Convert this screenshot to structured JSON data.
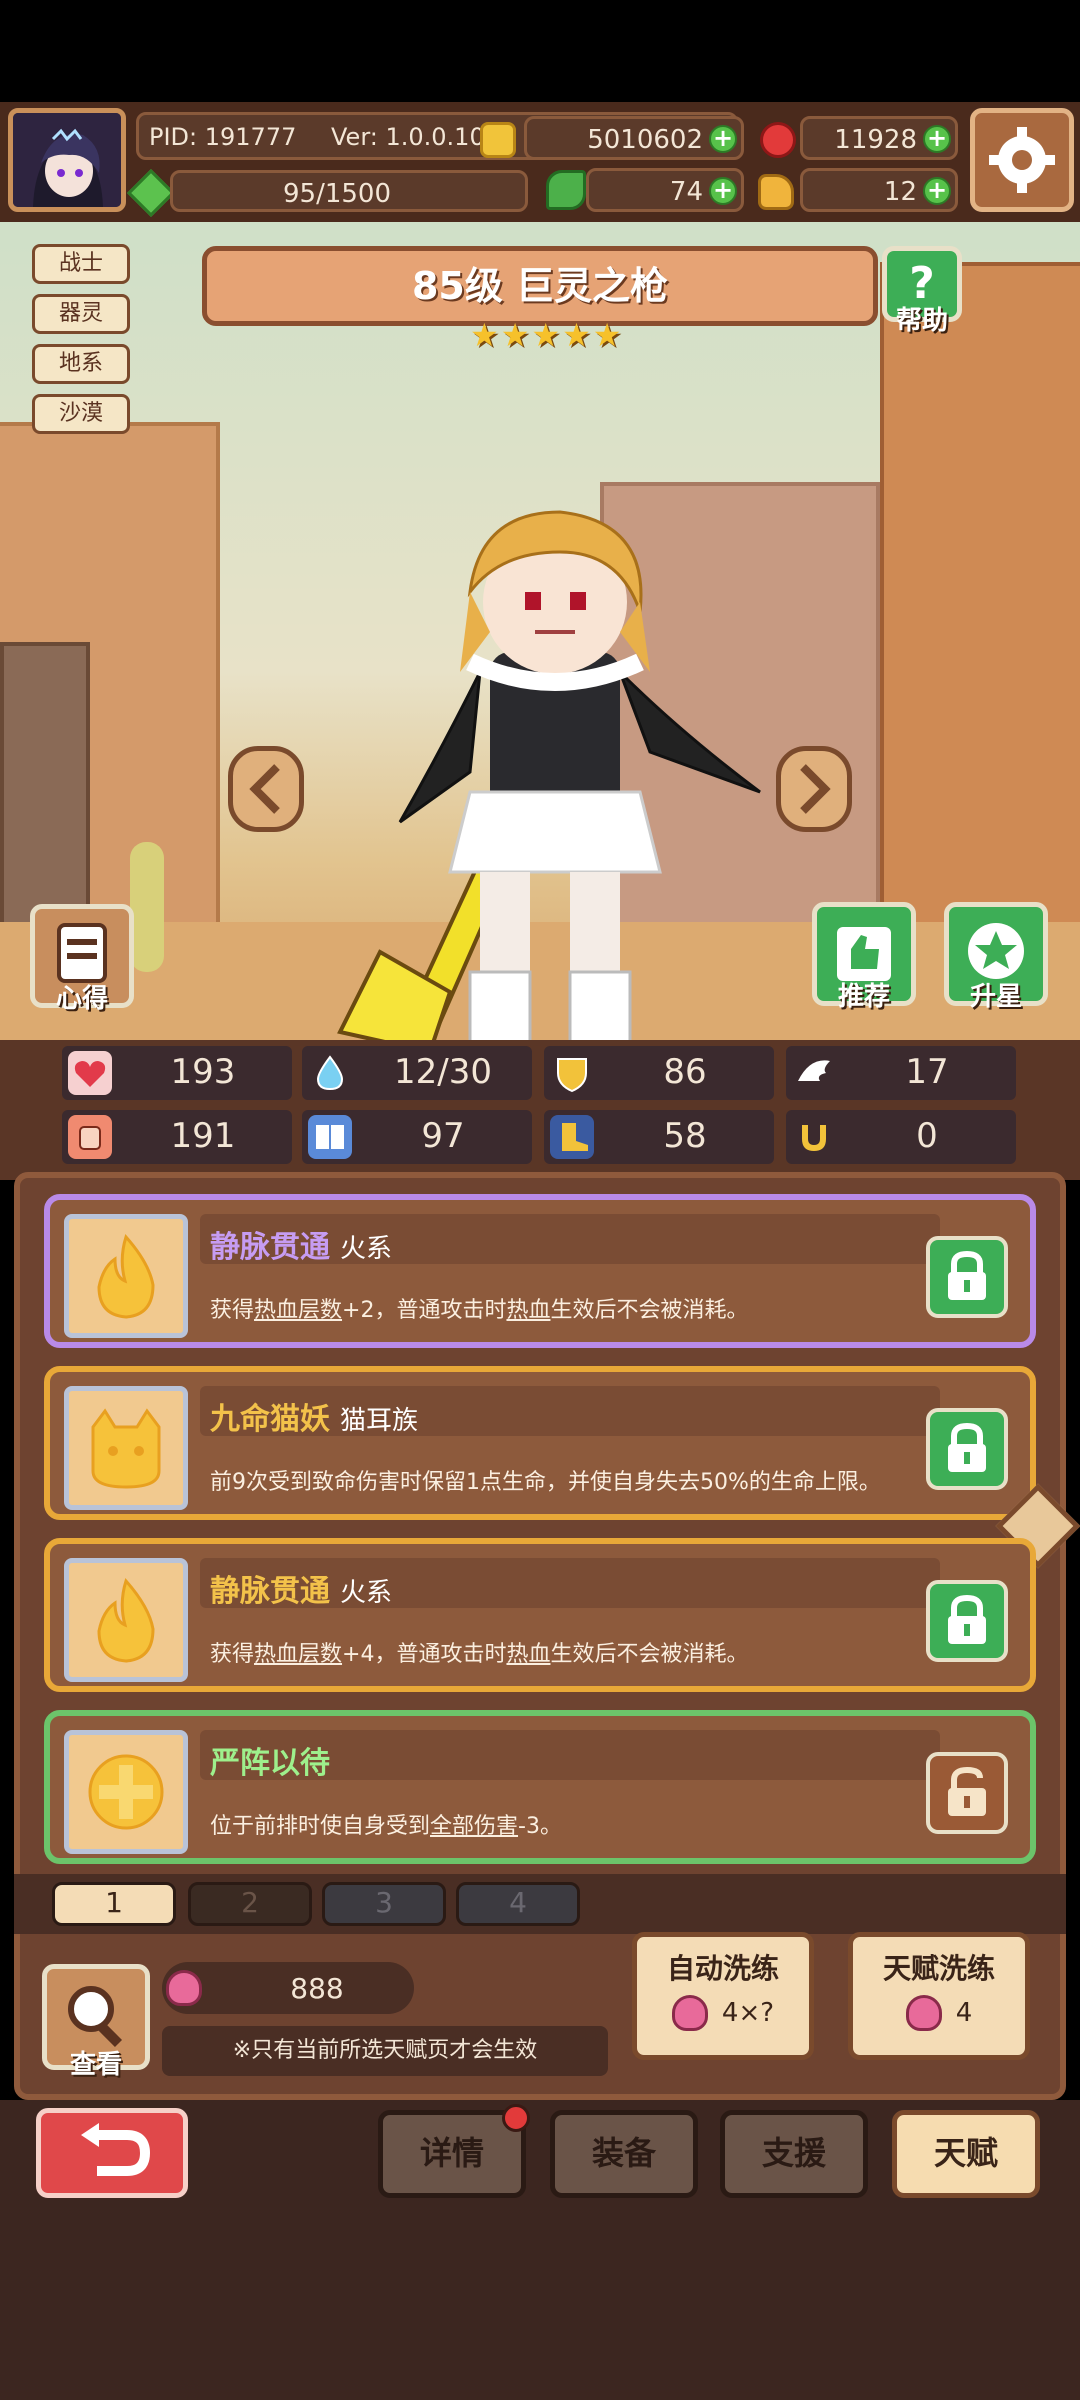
{
  "header": {
    "pid": "PID: 191777",
    "version": "Ver: 1.0.0.10",
    "gold": "5010602",
    "gems": "11928",
    "stamina": "95/1500",
    "clover": "74",
    "item": "12"
  },
  "tags": [
    "战士",
    "器灵",
    "地系",
    "沙漠"
  ],
  "hero": {
    "title": "85级 巨灵之枪",
    "stars": "★★★★★",
    "help_label": "帮助",
    "heart_label": "心得",
    "recommend_label": "推荐",
    "star_up_label": "升星"
  },
  "stats": {
    "hp": "193",
    "mp": "12/30",
    "defense": "86",
    "speed": "17",
    "attack": "191",
    "magic": "97",
    "crit": "58",
    "luck": "0"
  },
  "talents": [
    {
      "name": "静脉贯通",
      "type": "火系",
      "desc_parts": [
        "获得",
        "热血层数",
        "+2，普通攻击时",
        "热血",
        "生效后不会被消耗。"
      ],
      "name_color": "#c69cf2"
    },
    {
      "name": "九命猫妖",
      "type": "猫耳族",
      "desc_parts": [
        "前9次受到致命伤害时保留1点生命，并使自身失去50%的生命上限。"
      ],
      "name_color": "#f3c24a"
    },
    {
      "name": "静脉贯通",
      "type": "火系",
      "desc_parts": [
        "获得",
        "热血层数",
        "+4，普通攻击时",
        "热血",
        "生效后不会被消耗。"
      ],
      "name_color": "#f3c24a"
    },
    {
      "name": "严阵以待",
      "type": "",
      "desc_parts": [
        "位于前排时使自身受到",
        "全部伤害",
        "-3。"
      ],
      "name_color": "#9ef08c"
    }
  ],
  "pages": [
    "1",
    "2",
    "3",
    "4"
  ],
  "refine": {
    "count": "888",
    "view_label": "查看",
    "notice": "※只有当前所选天赋页才会生效",
    "auto_label": "自动洗练",
    "auto_cost": "4×?",
    "talent_label": "天赋洗练",
    "talent_cost": "4"
  },
  "nav": {
    "details": "详情",
    "equip": "装备",
    "support": "支援",
    "talent": "天赋"
  },
  "colors": {
    "panel_bg": "#6e4330",
    "card_purple": "#b98ae8",
    "card_gold": "#e8a838",
    "card_green": "#6cc46a",
    "lock_green": "#3dae56",
    "lock_brown": "#9a5a36",
    "back_red": "#e0484a"
  }
}
